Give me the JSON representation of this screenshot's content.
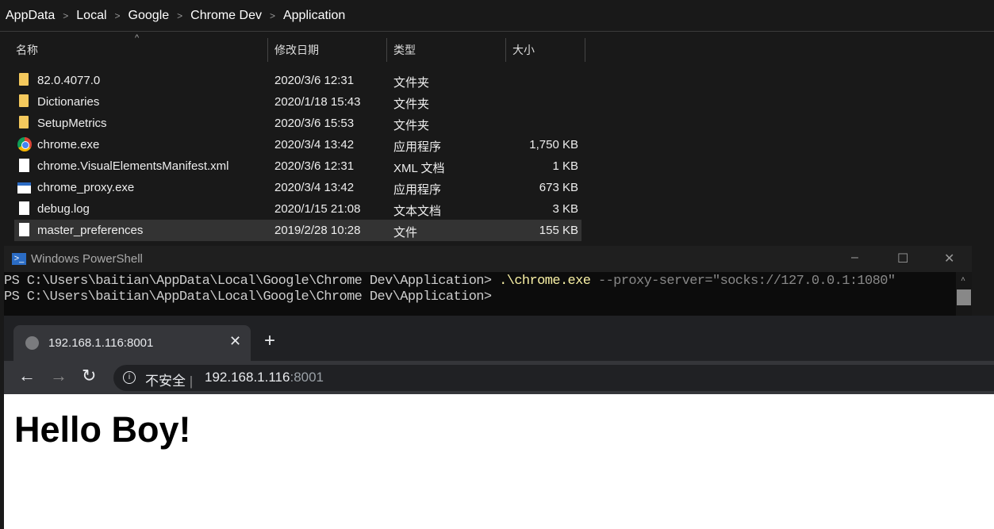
{
  "explorer": {
    "breadcrumb": [
      "AppData",
      "Local",
      "Google",
      "Chrome Dev",
      "Application"
    ],
    "columns": {
      "name": "名称",
      "date": "修改日期",
      "type": "类型",
      "size": "大小"
    },
    "files": [
      {
        "name": "82.0.4077.0",
        "date": "2020/3/6 12:31",
        "type": "文件夹",
        "size": "",
        "icon": "folder-icon"
      },
      {
        "name": "Dictionaries",
        "date": "2020/1/18 15:43",
        "type": "文件夹",
        "size": "",
        "icon": "folder-icon"
      },
      {
        "name": "SetupMetrics",
        "date": "2020/3/6 15:53",
        "type": "文件夹",
        "size": "",
        "icon": "folder-icon"
      },
      {
        "name": "chrome.exe",
        "date": "2020/3/4 13:42",
        "type": "应用程序",
        "size": "1,750 KB",
        "icon": "chrome-icon"
      },
      {
        "name": "chrome.VisualElementsManifest.xml",
        "date": "2020/3/6 12:31",
        "type": "XML 文档",
        "size": "1 KB",
        "icon": "file-icon"
      },
      {
        "name": "chrome_proxy.exe",
        "date": "2020/3/4 13:42",
        "type": "应用程序",
        "size": "673 KB",
        "icon": "exe-icon"
      },
      {
        "name": "debug.log",
        "date": "2020/1/15 21:08",
        "type": "文本文档",
        "size": "3 KB",
        "icon": "file-icon"
      },
      {
        "name": "master_preferences",
        "date": "2019/2/28 10:28",
        "type": "文件",
        "size": "155 KB",
        "icon": "file-icon",
        "selected": true
      }
    ]
  },
  "powershell": {
    "title": "Windows PowerShell",
    "prompt": "PS C:\\Users\\baitian\\AppData\\Local\\Google\\Chrome Dev\\Application>",
    "cmd": ".\\chrome.exe",
    "args": "--proxy-server=\"socks://127.0.0.1:1080\""
  },
  "chrome": {
    "tab_title": "192.168.1.116:8001",
    "security": "不安全",
    "url_host": "192.168.1.116",
    "url_port": ":8001",
    "page_heading": "Hello Boy!"
  }
}
